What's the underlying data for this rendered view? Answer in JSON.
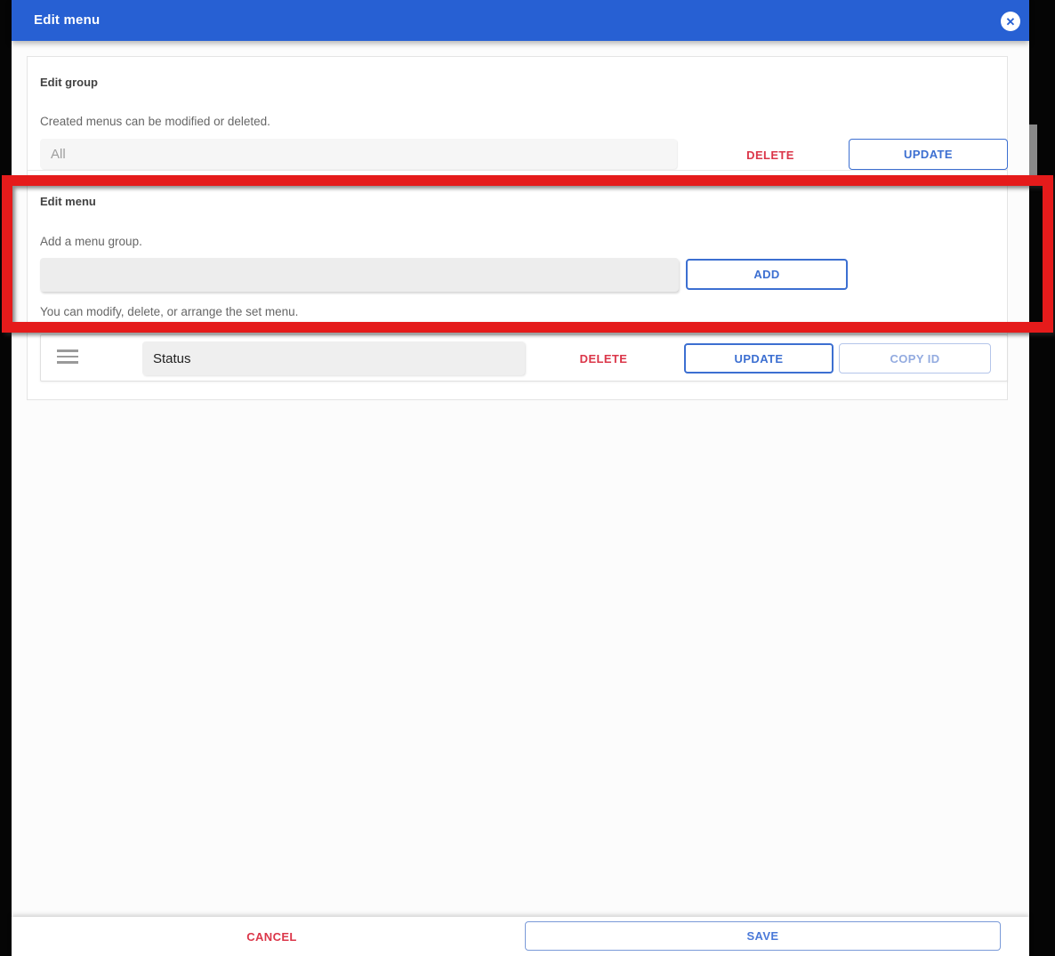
{
  "dialog": {
    "title": "Edit menu",
    "close_icon": "circle-x",
    "close_glyph": "✕"
  },
  "edit_group": {
    "heading": "Edit group",
    "description": "Created menus can be modified or deleted.",
    "input_value": "All",
    "delete_label": "DELETE",
    "update_label": "UPDATE"
  },
  "edit_menu": {
    "heading": "Edit menu",
    "add_description": "Add a menu group.",
    "add_input_value": "",
    "add_button_label": "ADD",
    "arrange_description": "You can modify, delete, or arrange the set menu.",
    "menu_items": [
      {
        "name": "Status",
        "delete_label": "DELETE",
        "update_label": "UPDATE",
        "copy_id_label": "COPY ID"
      }
    ]
  },
  "footer": {
    "cancel_label": "CANCEL",
    "save_label": "SAVE"
  },
  "annotation": {
    "shape": "rectangle",
    "color": "#e51b1b",
    "highlighted_section": "Edit menu"
  },
  "colors": {
    "header_blue": "#2760d3",
    "accent_blue": "#3c6fd1",
    "danger_red": "#db3649",
    "overlay_black": "#050505"
  }
}
